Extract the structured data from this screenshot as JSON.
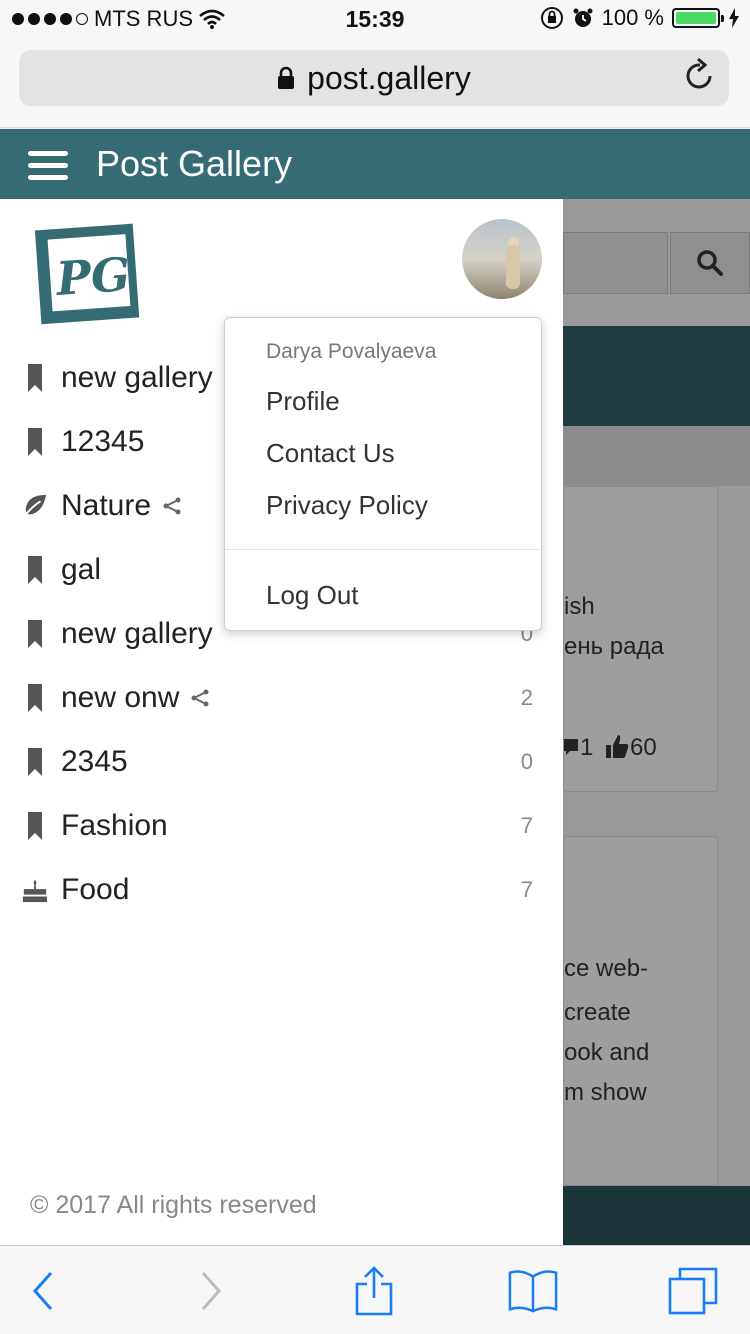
{
  "status_bar": {
    "carrier": "MTS RUS",
    "time": "15:39",
    "battery": "100 %"
  },
  "browser": {
    "url": "post.gallery"
  },
  "app": {
    "title": "Post Gallery"
  },
  "user": {
    "name": "Darya Povalyaeva"
  },
  "dropdown": {
    "items": [
      {
        "label": "Profile"
      },
      {
        "label": "Contact Us"
      },
      {
        "label": "Privacy Policy"
      }
    ],
    "logout": "Log Out"
  },
  "galleries": [
    {
      "label": "new gallery",
      "icon": "bookmark-icon",
      "shared": false,
      "count": ""
    },
    {
      "label": "12345",
      "icon": "bookmark-icon",
      "shared": false,
      "count": ""
    },
    {
      "label": "Nature",
      "icon": "leaf-icon",
      "shared": true,
      "count": ""
    },
    {
      "label": "gal",
      "icon": "bookmark-icon",
      "shared": false,
      "count": ""
    },
    {
      "label": "new gallery",
      "icon": "bookmark-icon",
      "shared": false,
      "count": "0"
    },
    {
      "label": "new onw",
      "icon": "bookmark-icon",
      "shared": true,
      "count": "2"
    },
    {
      "label": "2345",
      "icon": "bookmark-icon",
      "shared": false,
      "count": "0"
    },
    {
      "label": "Fashion",
      "icon": "bookmark-icon",
      "shared": false,
      "count": "7"
    },
    {
      "label": "Food",
      "icon": "cake-icon",
      "shared": false,
      "count": "7"
    }
  ],
  "footer": {
    "copyright": "© 2017 All rights reserved"
  },
  "background": {
    "card1_lines": [
      "ish",
      "ень рада"
    ],
    "card1_comments": "1",
    "card1_likes": "60",
    "card2_lines": [
      "ce web-",
      "create",
      "ook and",
      "m show"
    ]
  },
  "colors": {
    "header": "#356c74",
    "accent_dark": "#1f3c40",
    "ios_blue": "#1a7cf5"
  }
}
